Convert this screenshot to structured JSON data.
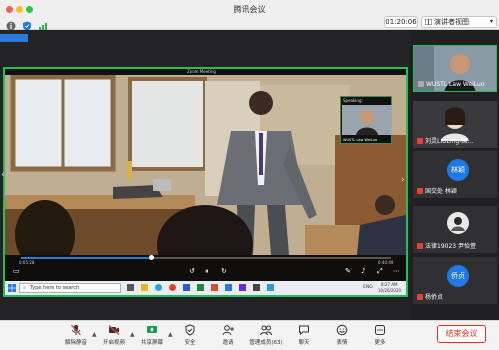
{
  "window": {
    "title": "腾讯会议",
    "timer": "01:20:06",
    "view_button": "演讲者视图"
  },
  "share": {
    "app_title": "Zoom Meeting",
    "speaking_label": "Speaking:",
    "speaker_pip_name": "WUSTL Law WeiLuo",
    "vid_current_time": "0:05:28",
    "vid_total_time": "0:40:49",
    "vid_progress": 0.36,
    "search_placeholder": "Type here to search",
    "clock_time": "8:27 AM",
    "clock_date": "10/26/2020",
    "lang": "ENG"
  },
  "participants": [
    {
      "name": "WUSTL Law WeiLuo",
      "type": "video",
      "mic": "active"
    },
    {
      "name": "刘灵LIULing-国…",
      "type": "video",
      "mic": "muted"
    },
    {
      "name": "国交处 林颖",
      "type": "avatar",
      "avatar_text": "林颖",
      "mic": "muted"
    },
    {
      "name": "法律19023 尹怡萱",
      "type": "photo",
      "mic": "muted"
    },
    {
      "name": "杨侨贞",
      "type": "avatar",
      "avatar_text": "侨贞",
      "mic": "muted"
    }
  ],
  "toolbar": {
    "mute": "解除静音",
    "video": "开启视频",
    "share": "共享屏幕",
    "security": "安全",
    "invite": "邀请",
    "members": "管理成员(63)",
    "chat": "聊天",
    "reactions": "表情",
    "more": "更多",
    "end": "结束会议"
  },
  "colors": {
    "share_border": "#22c05a",
    "end_red": "#e0302a",
    "accent_blue": "#1e78e6",
    "mute_red": "#e5403a"
  }
}
